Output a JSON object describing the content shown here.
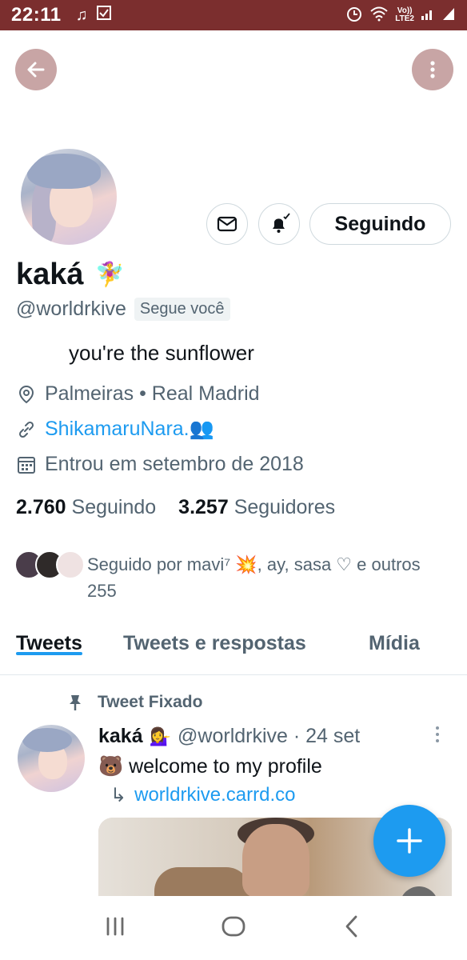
{
  "status_bar": {
    "time": "22:11",
    "network_top": "Vo))",
    "network_bottom": "LTE2",
    "icons": [
      "music-note-icon",
      "checklist-icon",
      "alarm-icon",
      "wifi-icon",
      "signal-icon",
      "signal-icon"
    ]
  },
  "header": {
    "back_icon": "arrow-left-icon",
    "more_icon": "more-vertical-icon",
    "header_button_color": "#c8a5a5"
  },
  "profile": {
    "name": "kaká",
    "name_emoji": "🧚‍♀️",
    "handle": "@worldrkive",
    "follows_you": "Segue você",
    "bio": "you're the sunflower",
    "location": "Palmeiras • Real Madrid",
    "website": "ShikamaruNara.👥",
    "joined": "Entrou em setembro de 2018",
    "following_count": "2.760",
    "following_label": "Seguindo",
    "followers_count": "3.257",
    "followers_label": "Seguidores",
    "followed_by_text": "Seguido por mavi⁷ 💥, ay, sasa ♡ e outros 255"
  },
  "actions": {
    "message_icon": "envelope-icon",
    "notify_icon": "bell-check-icon",
    "following_button": "Seguindo"
  },
  "tabs": [
    {
      "label": "Tweets",
      "active": true
    },
    {
      "label": "Tweets e respostas",
      "active": false
    },
    {
      "label": "Mídia",
      "active": false
    }
  ],
  "pinned_tweet": {
    "pinned_label": "Tweet Fixado",
    "author_name": "kaká",
    "author_emoji": "💁‍♀️",
    "handle_and_date": "@worldrkive · 24 set",
    "text": "🐻 welcome to my profile",
    "link_prefix": "↳",
    "link": "worldrkive.carrd.co"
  },
  "colors": {
    "status_bar": "#7b2e2e",
    "accent": "#1d9bf0",
    "secondary_text": "#536471",
    "primary_text": "#0f1419"
  },
  "navbar_icons": [
    "recent-apps-icon",
    "home-icon",
    "back-icon"
  ]
}
